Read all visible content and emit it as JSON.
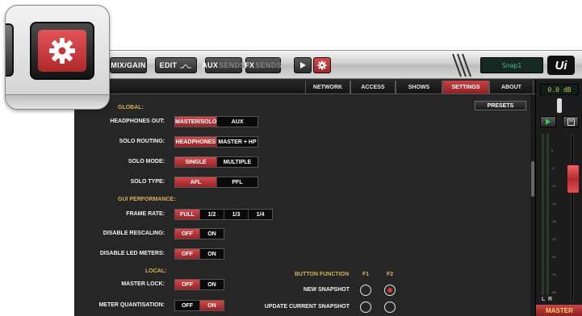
{
  "toolbar": {
    "mix_gain": "MIX/GAIN",
    "edit": "EDIT",
    "aux": "AUX",
    "aux_sends": "SENDS",
    "fx": "FX",
    "fx_sends": "SENDS",
    "snapshot_display": "Snap1",
    "logo": "Ui"
  },
  "tabs": [
    "NETWORK",
    "ACCESS",
    "SHOWS",
    "SETTINGS",
    "ABOUT"
  ],
  "active_tab": "SETTINGS",
  "presets_label": "PRESETS",
  "sections": {
    "global": "GLOBAL:",
    "gui_performance": "GUI PERFORMANCE:",
    "local": "LOCAL:"
  },
  "settings": [
    {
      "label": "HEADPHONES OUT:",
      "options": [
        "MASTER/SOLO",
        "AUX"
      ],
      "selected": "MASTER/SOLO"
    },
    {
      "label": "SOLO ROUTING:",
      "options": [
        "HEADPHONES",
        "MASTER + HP"
      ],
      "selected": "HEADPHONES"
    },
    {
      "label": "SOLO MODE:",
      "options": [
        "SINGLE",
        "MULTIPLE"
      ],
      "selected": "SINGLE"
    },
    {
      "label": "SOLO TYPE:",
      "options": [
        "AFL",
        "PFL"
      ],
      "selected": "AFL"
    },
    {
      "label": "FRAME RATE:",
      "options": [
        "FULL",
        "1/2",
        "1/3",
        "1/4"
      ],
      "selected": "FULL"
    },
    {
      "label": "DISABLE RESCALING:",
      "options": [
        "OFF",
        "ON"
      ],
      "selected": "OFF"
    },
    {
      "label": "DISABLE LED METERS:",
      "options": [
        "OFF",
        "ON"
      ],
      "selected": "OFF"
    },
    {
      "label": "MASTER LOCK:",
      "options": [
        "OFF",
        "ON"
      ],
      "selected": "OFF"
    },
    {
      "label": "METER QUANTISATION:",
      "options": [
        "OFF",
        "ON"
      ],
      "selected": "ON"
    }
  ],
  "button_function": {
    "title": "BUTTON FUNCTION",
    "col_f1": "F1",
    "col_f2": "F2",
    "rows": [
      {
        "label": "NEW SNAPSHOT",
        "f1": false,
        "f2": true
      },
      {
        "label": "UPDATE CURRENT SNAPSHOT",
        "f1": false,
        "f2": false
      }
    ]
  },
  "master": {
    "db": "0.0 dB",
    "meter_l": "L",
    "meter_r": "R",
    "label": "MASTER",
    "scale": [
      "0",
      "-6",
      "-12",
      "-24",
      "-36",
      "-48",
      "-60",
      "-76",
      "-88"
    ]
  },
  "colors": {
    "accent": "#c8393c",
    "section_header": "#d6b25a",
    "panel_bg": "#262626",
    "lcd_text": "#5fb58a"
  }
}
